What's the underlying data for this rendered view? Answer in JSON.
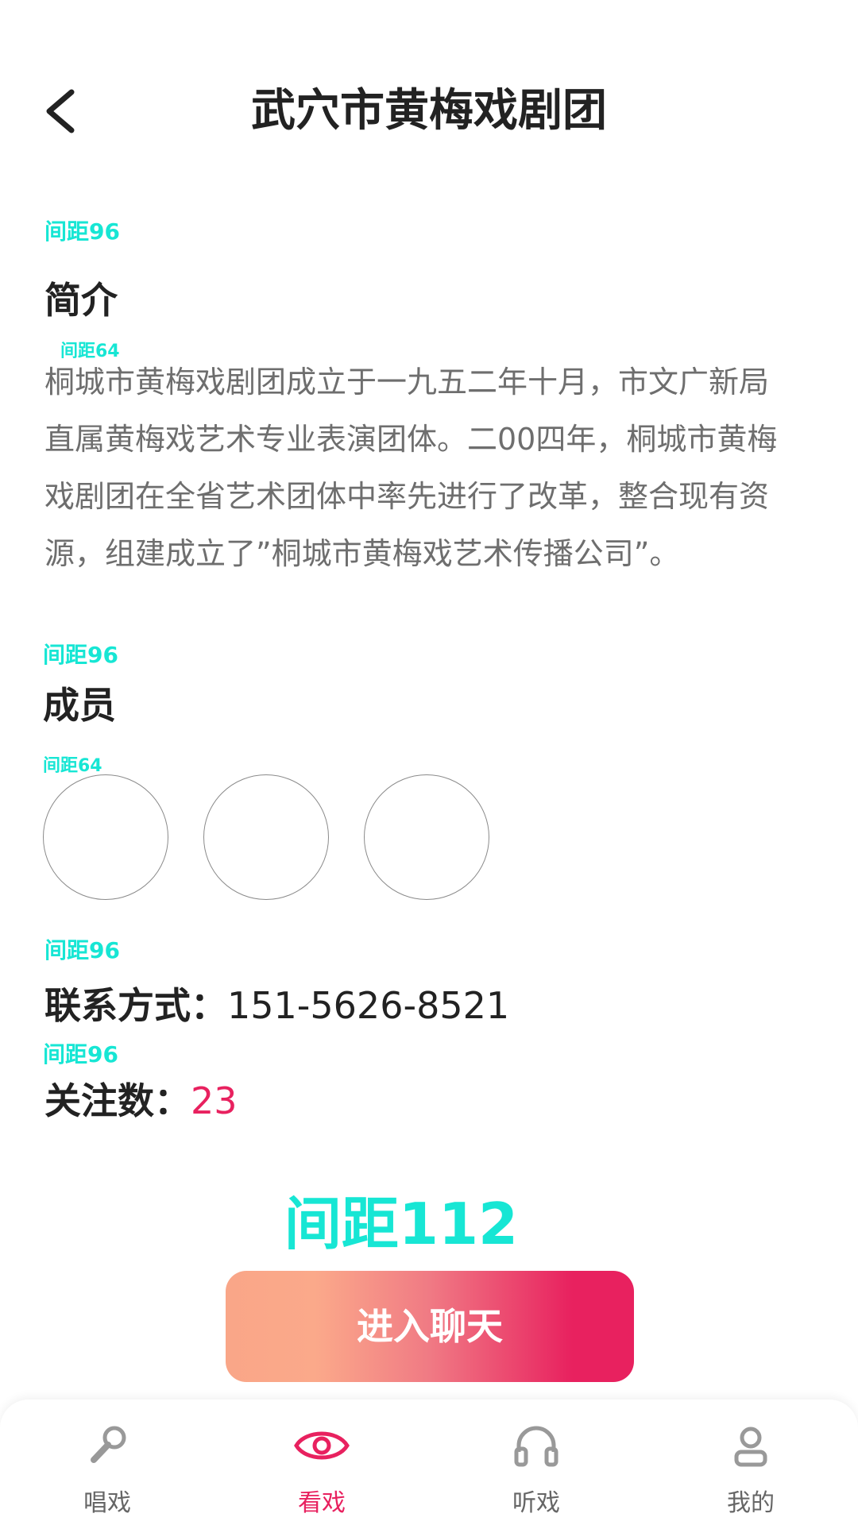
{
  "header": {
    "title": "武穴市黄梅戏剧团",
    "back_icon": "chevron-left-icon"
  },
  "notes": {
    "n1": "间距96",
    "n2": "间距64",
    "n3": "间距96",
    "n4": "间距64",
    "n5": "间距96",
    "n6": "间距96",
    "n7": "间距112"
  },
  "intro": {
    "heading": "简介",
    "text": "桐城市黄梅戏剧团成立于一九五二年十月，市文广新局直属黄梅戏艺术专业表演团体。二00四年，桐城市黄梅戏剧团在全省艺术团体中率先进行了改革，整合现有资源，组建成立了”桐城市黄梅戏艺术传播公司”。"
  },
  "members": {
    "heading": "成员"
  },
  "contact": {
    "label": "联系方式：",
    "value": "151-5626-8521"
  },
  "followers": {
    "label": "关注数：",
    "value": "23"
  },
  "chat_button": {
    "label": "进入聊天"
  },
  "tabbar": {
    "active": "看戏",
    "accent": "#e8215f",
    "items": [
      {
        "label": "唱戏",
        "icon": "microphone-icon"
      },
      {
        "label": "看戏",
        "icon": "eye-icon"
      },
      {
        "label": "听戏",
        "icon": "headphones-icon"
      },
      {
        "label": "我的",
        "icon": "user-icon"
      }
    ]
  }
}
